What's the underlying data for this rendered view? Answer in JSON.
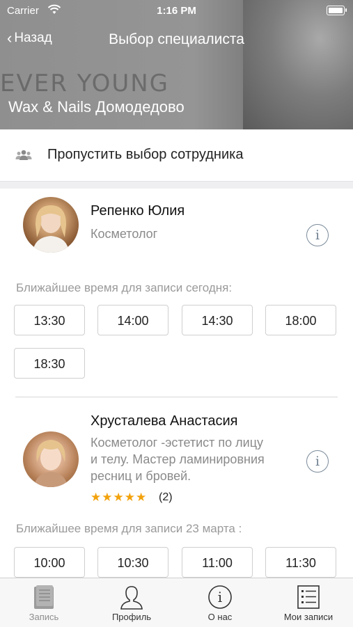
{
  "status_bar": {
    "carrier": "Carrier",
    "time": "1:16 PM"
  },
  "nav": {
    "back_label": "Назад",
    "title": "Выбор специалиста"
  },
  "banner": {
    "watermark": "EVER YOUNG",
    "salon_name": "Wax & Nails Домодедово"
  },
  "skip": {
    "label": "Пропустить выбор сотрудника"
  },
  "specialists": [
    {
      "name": "Репенко Юлия",
      "role": "Косметолог",
      "nearest_label": "Ближайшее время для записи сегодня:",
      "slots": [
        "13:30",
        "14:00",
        "14:30",
        "18:00",
        "18:30"
      ]
    },
    {
      "name": "Хрусталева Анастасия",
      "role_lines": [
        "Косметолог -эстетист по лицу",
        "и телу. Мастер ламинировния",
        "ресниц и бровей."
      ],
      "stars": "★★★★★",
      "rating_count": "(2)",
      "nearest_label": "Ближайшее время для записи 23 марта :",
      "slots": [
        "10:00",
        "10:30",
        "11:00",
        "11:30"
      ]
    }
  ],
  "tabs": [
    {
      "label": "Запись",
      "icon": "book-icon",
      "active": true
    },
    {
      "label": "Профиль",
      "icon": "person-icon",
      "active": false
    },
    {
      "label": "О нас",
      "icon": "info-icon",
      "active": false
    },
    {
      "label": "Мои записи",
      "icon": "list-icon",
      "active": false
    }
  ],
  "colors": {
    "star": "#f2a20c",
    "info_icon": "#6e7f90",
    "header_bg": "#8f8f8f"
  }
}
